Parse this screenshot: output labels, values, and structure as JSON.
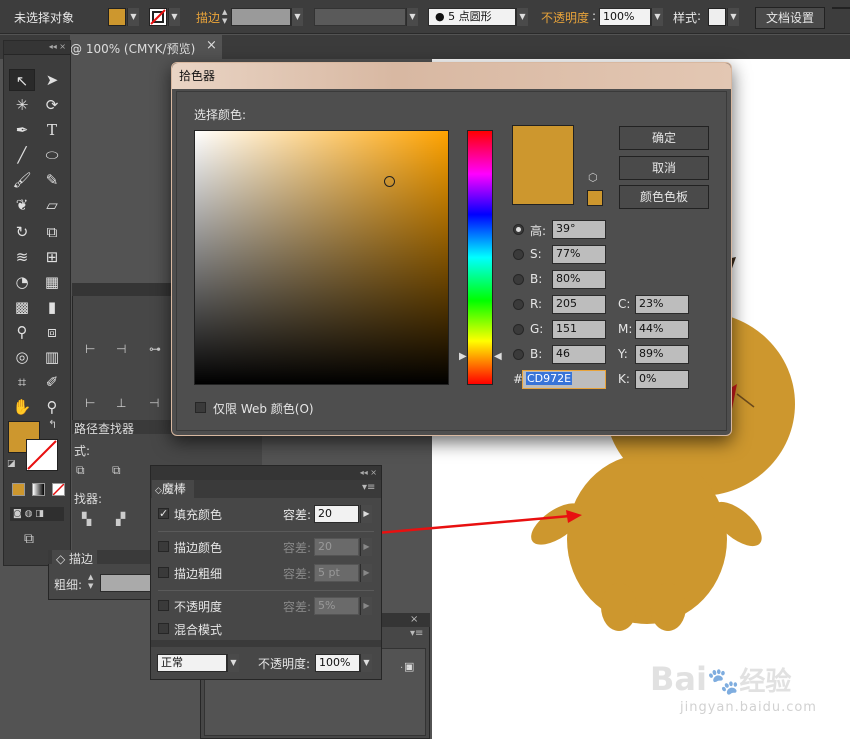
{
  "toolbar": {
    "selection_status": "未选择对象",
    "stroke_label": "描边",
    "brush_value": "5 点圆形",
    "opacity_label": "不透明度",
    "opacity_value": "100%",
    "style_label": "样式",
    "doc_setup_label": "文档设置",
    "fill_color": "#CD972E"
  },
  "document_tab": {
    "title": "@ 100% (CMYK/预览)",
    "close": "×"
  },
  "panels": {
    "pathfinder_title": "路径查找器",
    "pathfinder_shape_mode": "式:",
    "pathfinder_label": "找器:",
    "stroke_title": "描边",
    "stroke_weight_label": "粗细:",
    "collapse_glyph": "◂◂",
    "close_glyph": "×"
  },
  "magic_wand": {
    "title": "魔棒",
    "tolerance_label": "容差:",
    "fill_color": {
      "label": "填充颜色",
      "checked": true,
      "tolerance": "20"
    },
    "stroke_color": {
      "label": "描边颜色",
      "checked": false,
      "tolerance": "20"
    },
    "stroke_weight": {
      "label": "描边粗细",
      "checked": false,
      "tolerance": "5 pt"
    },
    "opacity": {
      "label": "不透明度",
      "checked": false,
      "tolerance": "5%"
    },
    "blend_mode": {
      "label": "混合模式",
      "checked": false
    },
    "blend_value": "正常",
    "opacity_label": "不透明度:",
    "opacity_value": "100%"
  },
  "color_picker": {
    "title": "拾色器",
    "select_color_label": "选择颜色:",
    "ok": "确定",
    "cancel": "取消",
    "swatches": "颜色色板",
    "hsb": [
      {
        "label": "高:",
        "value": "39°",
        "selected": true
      },
      {
        "label": "S:",
        "value": "77%",
        "selected": false
      },
      {
        "label": "B:",
        "value": "80%",
        "selected": false
      }
    ],
    "rgb": [
      {
        "label": "R:",
        "value": "205"
      },
      {
        "label": "G:",
        "value": "151"
      },
      {
        "label": "B:",
        "value": "46"
      }
    ],
    "cmyk": [
      {
        "label": "C:",
        "value": "23%"
      },
      {
        "label": "M:",
        "value": "44%"
      },
      {
        "label": "Y:",
        "value": "89%"
      },
      {
        "label": "K:",
        "value": "0%"
      }
    ],
    "hex_prefix": "#",
    "hex": "CD972E",
    "web_only_label": "仅限 Web 颜色(O)",
    "hue_color": "#FFA300",
    "current_color": "#CD972E"
  },
  "watermark": {
    "brand": "Bai",
    "brand_tail": "经验",
    "url": "jingyan.baidu.com"
  },
  "colors": {
    "accent_red": "#E81010",
    "character_fill": "#CD972E"
  }
}
